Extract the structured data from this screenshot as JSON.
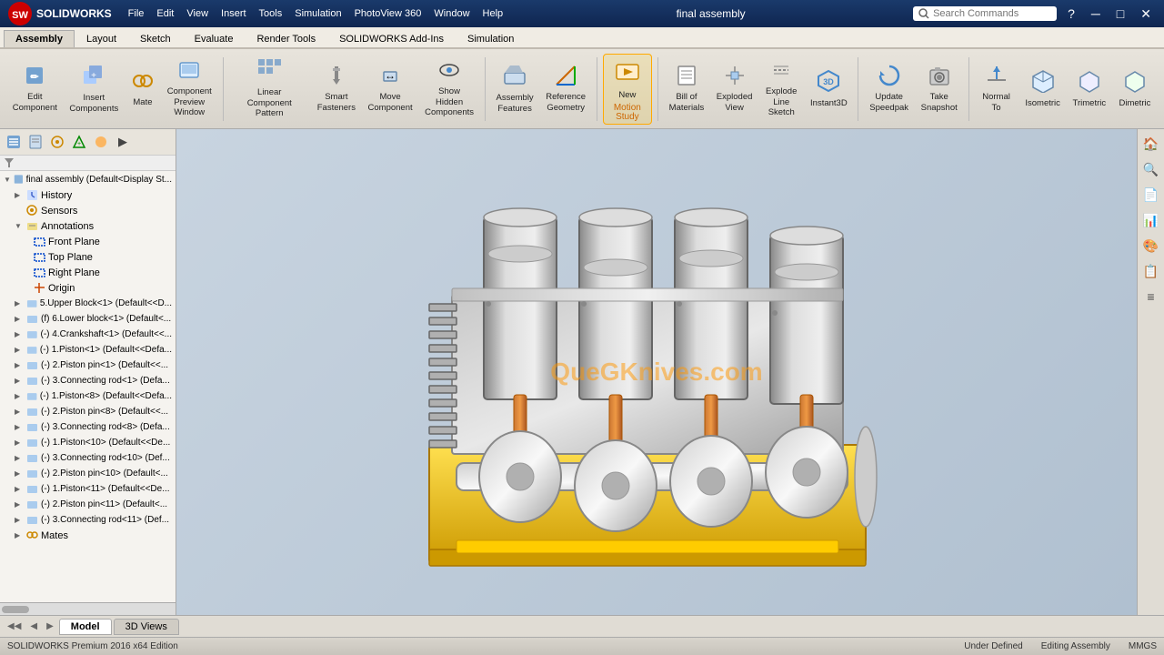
{
  "titlebar": {
    "app_name": "SOLIDWORKS",
    "file_title": "final assembly",
    "search_placeholder": "Search Commands"
  },
  "menu": {
    "items": [
      "File",
      "Edit",
      "View",
      "Insert",
      "Tools",
      "Simulation",
      "PhotoView 360",
      "Window",
      "Help"
    ]
  },
  "ribbon": {
    "tabs": [
      "Assembly",
      "Layout",
      "Sketch",
      "Evaluate",
      "Render Tools",
      "SOLIDWORKS Add-Ins",
      "Simulation"
    ],
    "active_tab": "Assembly"
  },
  "toolbar": {
    "buttons": [
      {
        "id": "edit-component",
        "label": "Edit\nComponent",
        "icon": "✏️"
      },
      {
        "id": "insert-components",
        "label": "Insert\nComponents",
        "icon": "📦"
      },
      {
        "id": "mate",
        "label": "Mate",
        "icon": "🔗"
      },
      {
        "id": "component-preview",
        "label": "Component\nPreview\nWindow",
        "icon": "🖼"
      },
      {
        "id": "linear-component-pattern",
        "label": "Linear Component\nPattern",
        "icon": "⊞"
      },
      {
        "id": "smart-fasteners",
        "label": "Smart\nFasteners",
        "icon": "🔩"
      },
      {
        "id": "move-component",
        "label": "Move\nComponent",
        "icon": "↔"
      },
      {
        "id": "show-hidden-components",
        "label": "Show\nHidden\nComponents",
        "icon": "👁"
      },
      {
        "id": "assembly-features",
        "label": "Assembly\nFeatures",
        "icon": "⚙"
      },
      {
        "id": "reference-geometry",
        "label": "Reference\nGeometry",
        "icon": "📐"
      },
      {
        "id": "new-motion-study",
        "label": "New\nMotion\nStudy",
        "icon": "🎬"
      },
      {
        "id": "bill-of-materials",
        "label": "Bill of\nMaterials",
        "icon": "📋"
      },
      {
        "id": "exploded-view",
        "label": "Exploded\nView",
        "icon": "💥"
      },
      {
        "id": "explode-line-sketch",
        "label": "Explode\nLine\nSketch",
        "icon": "📏"
      },
      {
        "id": "instant3d",
        "label": "Instant3D",
        "icon": "3️⃣"
      },
      {
        "id": "update-speedpak",
        "label": "Update\nSpeedpak",
        "icon": "🔄"
      },
      {
        "id": "take-snapshot",
        "label": "Take\nSnapshot",
        "icon": "📷"
      },
      {
        "id": "normal-to",
        "label": "Normal\nTo",
        "icon": "⊥"
      },
      {
        "id": "isometric",
        "label": "Isometric",
        "icon": "◈"
      },
      {
        "id": "trimetric",
        "label": "Trimetric",
        "icon": "◇"
      },
      {
        "id": "dimetric",
        "label": "Dimetric",
        "icon": "◆"
      }
    ]
  },
  "motion_study": {
    "label": "Motion",
    "sub_label": "Study"
  },
  "feature_tree": {
    "root": "final assembly  (Default<Display St...",
    "items": [
      {
        "id": "history",
        "label": "History",
        "icon": "📋",
        "indent": 1,
        "expandable": true
      },
      {
        "id": "sensors",
        "label": "Sensors",
        "icon": "📡",
        "indent": 1
      },
      {
        "id": "annotations",
        "label": "Annotations",
        "icon": "📝",
        "indent": 1,
        "expandable": true
      },
      {
        "id": "front-plane",
        "label": "Front Plane",
        "icon": "◻",
        "indent": 2
      },
      {
        "id": "top-plane",
        "label": "Top Plane",
        "icon": "◻",
        "indent": 2
      },
      {
        "id": "right-plane",
        "label": "Right Plane",
        "icon": "◻",
        "indent": 2
      },
      {
        "id": "origin",
        "label": "Origin",
        "icon": "✛",
        "indent": 2
      },
      {
        "id": "upper-block",
        "label": "5.Upper Block<1> (Default<<D...",
        "icon": "⚙",
        "indent": 1
      },
      {
        "id": "lower-block",
        "label": "(f) 6.Lower block<1> (Default<...",
        "icon": "⚙",
        "indent": 1
      },
      {
        "id": "crankshaft",
        "label": "(-) 4.Crankshaft<1> (Default<<...",
        "icon": "⚙",
        "indent": 1
      },
      {
        "id": "piston1",
        "label": "(-) 1.Piston<1> (Default<<Defa...",
        "icon": "⚙",
        "indent": 1
      },
      {
        "id": "piston-pin1",
        "label": "(-) 2.Piston pin<1> (Default<<...",
        "icon": "⚙",
        "indent": 1
      },
      {
        "id": "connecting-rod1",
        "label": "(-) 3.Connecting rod<1> (Defa...",
        "icon": "⚙",
        "indent": 1
      },
      {
        "id": "piston8",
        "label": "(-) 1.Piston<8> (Default<<Defa...",
        "icon": "⚙",
        "indent": 1
      },
      {
        "id": "piston-pin8",
        "label": "(-) 2.Piston pin<8> (Default<<...",
        "icon": "⚙",
        "indent": 1
      },
      {
        "id": "connecting-rod8",
        "label": "(-) 3.Connecting rod<8> (Defa...",
        "icon": "⚙",
        "indent": 1
      },
      {
        "id": "piston10",
        "label": "(-) 1.Piston<10> (Default<<De...",
        "icon": "⚙",
        "indent": 1
      },
      {
        "id": "connecting-rod10",
        "label": "(-) 3.Connecting rod<10> (Def...",
        "icon": "⚙",
        "indent": 1
      },
      {
        "id": "piston-pin10",
        "label": "(-) 2.Piston pin<10> (Default<...",
        "icon": "⚙",
        "indent": 1
      },
      {
        "id": "piston11",
        "label": "(-) 1.Piston<11> (Default<<De...",
        "icon": "⚙",
        "indent": 1
      },
      {
        "id": "piston-pin11",
        "label": "(-) 2.Piston pin<11> (Default<...",
        "icon": "⚙",
        "indent": 1
      },
      {
        "id": "connecting-rod11",
        "label": "(-) 3.Connecting rod<11> (Def...",
        "icon": "⚙",
        "indent": 1
      },
      {
        "id": "mates",
        "label": "Mates",
        "icon": "🔗",
        "indent": 1
      }
    ]
  },
  "right_panel": {
    "buttons": [
      "🏠",
      "🔍",
      "📄",
      "📊",
      "🎨",
      "📋",
      "≡"
    ]
  },
  "status_bar": {
    "edition": "SOLIDWORKS Premium 2016 x64 Edition",
    "status": "Under Defined",
    "mode": "Editing Assembly",
    "units": "MMGS"
  },
  "bottom_tabs": {
    "tabs": [
      "Model",
      "3D Views"
    ],
    "active": "Model"
  },
  "watermark": "QueGKnives.com"
}
